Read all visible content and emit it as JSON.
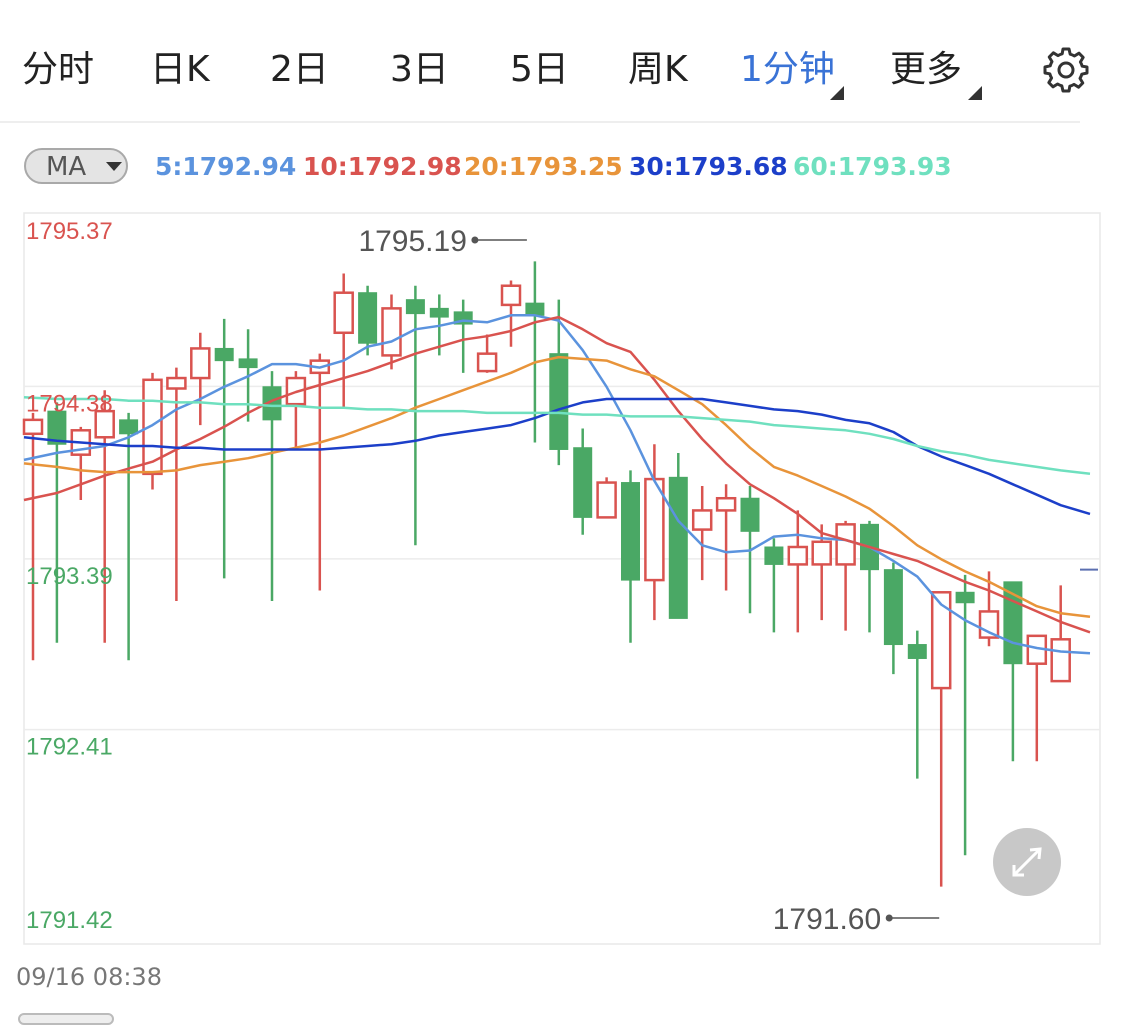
{
  "tabs": [
    {
      "label": "分时",
      "active": false
    },
    {
      "label": "日K",
      "active": false
    },
    {
      "label": "2日",
      "active": false
    },
    {
      "label": "3日",
      "active": false
    },
    {
      "label": "5日",
      "active": false
    },
    {
      "label": "周K",
      "active": false
    },
    {
      "label": "1分钟",
      "active": true,
      "has_menu": true
    },
    {
      "label": "更多",
      "active": false,
      "has_menu": true
    }
  ],
  "settings_icon": "gear-icon",
  "ma_selector": {
    "label": "MA"
  },
  "ma_values": [
    {
      "text": "5:1792.94",
      "color": "#5b93de"
    },
    {
      "text": "10:1792.98",
      "color": "#d9534f"
    },
    {
      "text": "20:1793.25",
      "color": "#e8943a"
    },
    {
      "text": "30:1793.68",
      "color": "#1c3fc9"
    },
    {
      "text": "60:1793.93",
      "color": "#6fe0bf"
    }
  ],
  "chart_data": {
    "type": "candlestick",
    "ylim": [
      1791.42,
      1795.37
    ],
    "price_labels": [
      {
        "value": 1795.37,
        "text": "1795.37",
        "color": "#d9534f"
      },
      {
        "value": 1794.38,
        "text": "1794.38",
        "color": "#d9534f"
      },
      {
        "value": 1793.39,
        "text": "1793.39",
        "color": "#4aa865"
      },
      {
        "value": 1792.41,
        "text": "1792.41",
        "color": "#4aa865"
      },
      {
        "value": 1791.42,
        "text": "1791.42",
        "color": "#4aa865"
      }
    ],
    "annotations": {
      "high": {
        "value": 1795.19,
        "text": "1795.19",
        "candle_index": 21
      },
      "low": {
        "value": 1791.6,
        "text": "1791.60",
        "candle_index": 38
      }
    },
    "candles": [
      {
        "open": 1794.2,
        "close": 1794.28,
        "high": 1794.32,
        "low": 1792.9,
        "rising": true
      },
      {
        "open": 1794.33,
        "close": 1794.14,
        "high": 1794.38,
        "low": 1793.0,
        "rising": false
      },
      {
        "open": 1794.08,
        "close": 1794.22,
        "high": 1794.24,
        "low": 1793.82,
        "rising": true
      },
      {
        "open": 1794.18,
        "close": 1794.33,
        "high": 1794.45,
        "low": 1793.0,
        "rising": true
      },
      {
        "open": 1794.28,
        "close": 1794.2,
        "high": 1794.32,
        "low": 1792.9,
        "rising": false
      },
      {
        "open": 1793.97,
        "close": 1794.51,
        "high": 1794.55,
        "low": 1793.88,
        "rising": true
      },
      {
        "open": 1794.46,
        "close": 1794.52,
        "high": 1794.58,
        "low": 1793.24,
        "rising": true
      },
      {
        "open": 1794.52,
        "close": 1794.69,
        "high": 1794.78,
        "low": 1794.25,
        "rising": true
      },
      {
        "open": 1794.69,
        "close": 1794.62,
        "high": 1794.86,
        "low": 1793.37,
        "rising": false
      },
      {
        "open": 1794.63,
        "close": 1794.58,
        "high": 1794.8,
        "low": 1794.27,
        "rising": false
      },
      {
        "open": 1794.47,
        "close": 1794.28,
        "high": 1794.56,
        "low": 1793.24,
        "rising": false
      },
      {
        "open": 1794.37,
        "close": 1794.52,
        "high": 1794.56,
        "low": 1794.12,
        "rising": true
      },
      {
        "open": 1794.55,
        "close": 1794.62,
        "high": 1794.66,
        "low": 1793.3,
        "rising": true
      },
      {
        "open": 1794.78,
        "close": 1795.01,
        "high": 1795.12,
        "low": 1794.35,
        "rising": true
      },
      {
        "open": 1795.01,
        "close": 1794.72,
        "high": 1795.05,
        "low": 1794.65,
        "rising": false
      },
      {
        "open": 1794.65,
        "close": 1794.92,
        "high": 1795.0,
        "low": 1794.57,
        "rising": true
      },
      {
        "open": 1794.97,
        "close": 1794.89,
        "high": 1795.05,
        "low": 1793.56,
        "rising": false
      },
      {
        "open": 1794.92,
        "close": 1794.87,
        "high": 1795.0,
        "low": 1794.65,
        "rising": false
      },
      {
        "open": 1794.9,
        "close": 1794.83,
        "high": 1794.97,
        "low": 1794.55,
        "rising": false
      },
      {
        "open": 1794.56,
        "close": 1794.66,
        "high": 1794.77,
        "low": 1794.55,
        "rising": true
      },
      {
        "open": 1794.94,
        "close": 1795.05,
        "high": 1795.08,
        "low": 1794.7,
        "rising": true
      },
      {
        "open": 1794.95,
        "close": 1794.88,
        "high": 1795.19,
        "low": 1794.15,
        "rising": false
      },
      {
        "open": 1794.66,
        "close": 1794.11,
        "high": 1794.97,
        "low": 1794.02,
        "rising": false
      },
      {
        "open": 1794.12,
        "close": 1793.72,
        "high": 1794.23,
        "low": 1793.62,
        "rising": false
      },
      {
        "open": 1793.72,
        "close": 1793.92,
        "high": 1793.95,
        "low": 1793.72,
        "rising": true
      },
      {
        "open": 1793.92,
        "close": 1793.36,
        "high": 1793.99,
        "low": 1793.0,
        "rising": false
      },
      {
        "open": 1793.36,
        "close": 1793.94,
        "high": 1794.14,
        "low": 1793.13,
        "rising": true
      },
      {
        "open": 1793.95,
        "close": 1793.14,
        "high": 1794.09,
        "low": 1793.14,
        "rising": false
      },
      {
        "open": 1793.65,
        "close": 1793.76,
        "high": 1793.9,
        "low": 1793.36,
        "rising": true
      },
      {
        "open": 1793.76,
        "close": 1793.83,
        "high": 1793.91,
        "low": 1793.3,
        "rising": true
      },
      {
        "open": 1793.83,
        "close": 1793.64,
        "high": 1793.9,
        "low": 1793.17,
        "rising": false
      },
      {
        "open": 1793.55,
        "close": 1793.45,
        "high": 1793.6,
        "low": 1793.06,
        "rising": false
      },
      {
        "open": 1793.45,
        "close": 1793.55,
        "high": 1793.76,
        "low": 1793.06,
        "rising": true
      },
      {
        "open": 1793.45,
        "close": 1793.58,
        "high": 1793.68,
        "low": 1793.13,
        "rising": true
      },
      {
        "open": 1793.45,
        "close": 1793.68,
        "high": 1793.7,
        "low": 1793.07,
        "rising": true
      },
      {
        "open": 1793.68,
        "close": 1793.42,
        "high": 1793.7,
        "low": 1793.06,
        "rising": false
      },
      {
        "open": 1793.42,
        "close": 1792.99,
        "high": 1793.46,
        "low": 1792.82,
        "rising": false
      },
      {
        "open": 1792.99,
        "close": 1792.91,
        "high": 1793.07,
        "low": 1792.22,
        "rising": false
      },
      {
        "open": 1792.74,
        "close": 1793.29,
        "high": 1793.29,
        "low": 1791.6,
        "rising": true
      },
      {
        "open": 1793.29,
        "close": 1793.23,
        "high": 1793.39,
        "low": 1791.78,
        "rising": false
      },
      {
        "open": 1793.03,
        "close": 1793.18,
        "high": 1793.41,
        "low": 1792.98,
        "rising": true
      },
      {
        "open": 1793.35,
        "close": 1792.88,
        "high": 1793.35,
        "low": 1792.32,
        "rising": false
      },
      {
        "open": 1792.88,
        "close": 1793.04,
        "high": 1793.04,
        "low": 1792.32,
        "rising": true
      },
      {
        "open": 1792.78,
        "close": 1793.02,
        "high": 1793.33,
        "low": 1792.78,
        "rising": true
      }
    ],
    "ma_lines": [
      {
        "name": "5",
        "color": "#5b93de",
        "values": [
          1794.05,
          1794.09,
          1794.11,
          1794.13,
          1794.18,
          1794.25,
          1794.34,
          1794.4,
          1794.47,
          1794.53,
          1794.6,
          1794.6,
          1794.58,
          1794.62,
          1794.7,
          1794.73,
          1794.8,
          1794.82,
          1794.85,
          1794.84,
          1794.88,
          1794.88,
          1794.85,
          1794.68,
          1794.47,
          1794.22,
          1793.93,
          1793.7,
          1793.56,
          1793.52,
          1793.53,
          1793.61,
          1793.62,
          1793.6,
          1793.59,
          1793.55,
          1793.47,
          1793.38,
          1793.22,
          1793.13,
          1793.06,
          1793.0,
          1792.97,
          1792.95,
          1792.94
        ]
      },
      {
        "name": "10",
        "color": "#d9534f",
        "values": [
          1793.82,
          1793.86,
          1793.91,
          1793.96,
          1794.0,
          1794.04,
          1794.11,
          1794.17,
          1794.24,
          1794.32,
          1794.39,
          1794.44,
          1794.48,
          1794.52,
          1794.56,
          1794.61,
          1794.66,
          1794.7,
          1794.74,
          1794.76,
          1794.79,
          1794.84,
          1794.87,
          1794.8,
          1794.72,
          1794.67,
          1794.51,
          1794.33,
          1794.17,
          1794.03,
          1793.91,
          1793.83,
          1793.74,
          1793.63,
          1793.59,
          1793.55,
          1793.51,
          1793.47,
          1793.41,
          1793.35,
          1793.3,
          1793.24,
          1793.18,
          1793.12,
          1793.06
        ]
      },
      {
        "name": "20",
        "color": "#e8943a",
        "values": [
          1794.03,
          1794.01,
          1793.99,
          1793.98,
          1793.98,
          1793.98,
          1793.99,
          1794.02,
          1794.04,
          1794.06,
          1794.09,
          1794.12,
          1794.15,
          1794.19,
          1794.24,
          1794.29,
          1794.35,
          1794.4,
          1794.45,
          1794.5,
          1794.55,
          1794.61,
          1794.64,
          1794.63,
          1794.62,
          1794.57,
          1794.53,
          1794.45,
          1794.37,
          1794.25,
          1794.12,
          1794.01,
          1793.96,
          1793.9,
          1793.84,
          1793.77,
          1793.67,
          1793.56,
          1793.48,
          1793.41,
          1793.35,
          1793.28,
          1793.21,
          1793.17,
          1793.15
        ]
      },
      {
        "name": "30",
        "color": "#1c3fc9",
        "values": [
          1794.18,
          1794.16,
          1794.15,
          1794.14,
          1794.13,
          1794.13,
          1794.12,
          1794.12,
          1794.11,
          1794.11,
          1794.11,
          1794.11,
          1794.11,
          1794.12,
          1794.13,
          1794.14,
          1794.16,
          1794.19,
          1794.21,
          1794.23,
          1794.25,
          1794.29,
          1794.34,
          1794.38,
          1794.4,
          1794.4,
          1794.4,
          1794.4,
          1794.4,
          1794.38,
          1794.36,
          1794.34,
          1794.33,
          1794.31,
          1794.28,
          1794.26,
          1794.21,
          1794.13,
          1794.07,
          1794.02,
          1793.97,
          1793.91,
          1793.85,
          1793.79,
          1793.74
        ]
      },
      {
        "name": "60",
        "color": "#6fe0bf",
        "values": [
          1794.41,
          1794.4,
          1794.4,
          1794.4,
          1794.39,
          1794.39,
          1794.38,
          1794.38,
          1794.37,
          1794.37,
          1794.36,
          1794.36,
          1794.35,
          1794.35,
          1794.34,
          1794.34,
          1794.33,
          1794.33,
          1794.33,
          1794.32,
          1794.32,
          1794.32,
          1794.32,
          1794.31,
          1794.31,
          1794.3,
          1794.3,
          1794.3,
          1794.29,
          1794.28,
          1794.27,
          1794.25,
          1794.24,
          1794.23,
          1794.22,
          1794.2,
          1794.17,
          1794.13,
          1794.1,
          1794.08,
          1794.05,
          1794.03,
          1794.01,
          1793.99,
          1793.97
        ]
      }
    ],
    "last_price": 1793.42
  },
  "expand_icon": "expand-icon",
  "footer": {
    "time": "09/16 08:38"
  }
}
